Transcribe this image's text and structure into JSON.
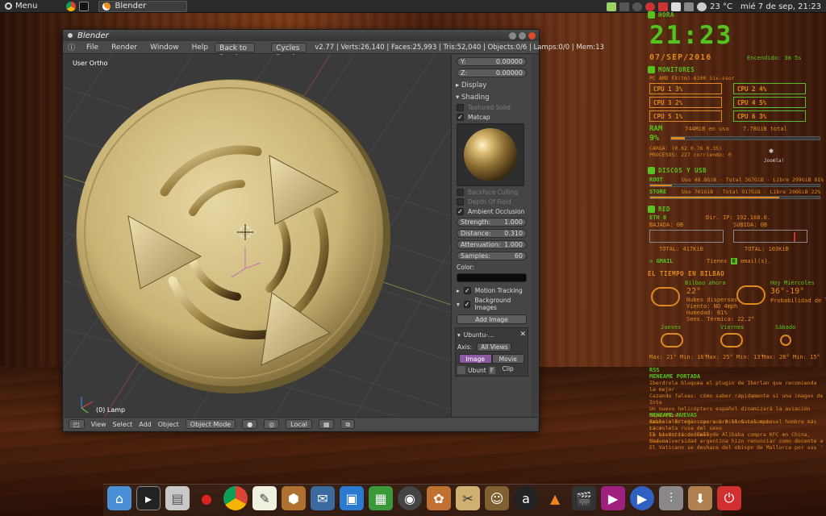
{
  "top_panel": {
    "menu_label": "Menu",
    "active_window": "Blender",
    "temperature": "23 °C",
    "datetime": "mié 7 de sep, 21:23"
  },
  "blender": {
    "title": "Blender",
    "menus": [
      "File",
      "Render",
      "Window",
      "Help"
    ],
    "back_button": "Back to Previous",
    "engine": "Cycles Render",
    "stats": "v2.77 | Verts:26,140 | Faces:25,993 | Tris:52,040 | Objects:0/6 | Lamps:0/0 | Mem:13",
    "viewport_label": "User Ortho",
    "lamp_label": "(0) Lamp",
    "npanel": {
      "y_label": "Y:",
      "y_value": "0.00000",
      "z_label": "Z:",
      "z_value": "0.00000",
      "display": "Display",
      "shading": "Shading",
      "textured_solid": "Textured Solid",
      "matcap": "Matcap",
      "backface_culling": "Backface Culling",
      "depth_of_field": "Depth Of Field",
      "ambient_occlusion": "Ambient Occlusion",
      "strength_label": "Strength:",
      "strength_value": "1.000",
      "distance_label": "Distance:",
      "distance_value": "0.310",
      "attenuation_label": "Attenuation:",
      "attenuation_value": "1.000",
      "samples_label": "Samples:",
      "samples_value": "60",
      "color_label": "Color:",
      "motion_tracking": "Motion Tracking",
      "background_images": "Background Images",
      "add_image": "Add Image",
      "image_name": "Ubuntu-...",
      "axis_label": "Axis:",
      "axis_value": "All Views",
      "tab_image": "Image",
      "tab_movie": "Movie Clip",
      "file_field": "Ubunt",
      "file_btn": "F"
    },
    "footer": {
      "view": "View",
      "select": "Select",
      "add": "Add",
      "object": "Object",
      "mode": "Object Mode",
      "orientation": "Local"
    }
  },
  "conky": {
    "hora_head": "HORA",
    "clock": "21:23",
    "date": "07/SEP/2016",
    "uptime": "Encendido: 3m 5s",
    "monitores_head": "MONITORES",
    "cpu_model": "PC AMD FX(tm)-6100 Six-ssor",
    "cpus": [
      {
        "label": "CPU 1",
        "value": "3%"
      },
      {
        "label": "CPU 2",
        "value": "4%"
      },
      {
        "label": "CPU 3",
        "value": "2%"
      },
      {
        "label": "CPU 4",
        "value": "5%"
      },
      {
        "label": "CPU 5",
        "value": "1%"
      },
      {
        "label": "CPU 6",
        "value": "3%"
      }
    ],
    "ram_label": "RAM",
    "ram_pct": "9%",
    "ram_used": "744MiB en uso",
    "ram_total": "7.78GiB total",
    "carga": "CARGA: (0.62 0.76 0.35)",
    "procesos": "PROCESOS: 227  corriendo: 0",
    "discos_head": "DISCOS Y USB",
    "root_label": "ROOT",
    "root_text": "Uso 48.8GiB - Total 367GiB - Libre 299GiB 81%",
    "store_label": "STORE",
    "store_text": "Uso 701GiB - Total 917GiB - Libre 206GiB 22%",
    "red_head": "RED",
    "eth": "ETH 0",
    "dir_ip": "Dir. IP: 192.168.0.",
    "bajada": "BAJADA: 0B",
    "subida": "SUBIDA: 0B",
    "total_down": "TOTAL: 417KiB",
    "total_up": "TOTAL: 103KiB",
    "gmail_label": "GMAIL",
    "gmail_text": "Tienes",
    "gmail_count": "0",
    "gmail_suffix": "email(s).",
    "tiempo_head": "EL TIEMPO EN BILBAO",
    "bilbao_ahora": "Bilbao ahora",
    "temp_now": "22°",
    "cond_now": "Nubes dispersas",
    "viento": "Viento: NO 4mph",
    "humedad": "Humedad: 81%",
    "sensacion": "Sens. Térmica: 22.2°",
    "hoy": "Hoy Miércoles",
    "hoy_range": "36°-19°",
    "hoy_prob": "Probabilidad de llu",
    "forecast": [
      {
        "day": "Jueves",
        "range": "Max: 21°  Min: 16°"
      },
      {
        "day": "Viernes",
        "range": "Max: 25°  Min: 13°"
      },
      {
        "day": "Sábado",
        "range": "Max: 26°  Min: 15°"
      }
    ],
    "rss_head": "RSS",
    "rss_portada": "MENEAME PORTADA",
    "rss_portada_items": [
      "Iberdrola bloquea el plugin de Iberlan que recomienda la mejor",
      "Cazando falses: cómo saber rápidamente si una imagen de Inte",
      "Un nuevo helicóptero español dinamizará la aviación deportiva",
      "Amancio Ortega supera a Bill Gates como el hombre más rico",
      "El excéntrico dueño de Alibaba compra KFC en China, cadena"
    ],
    "rss_nuevas": "MENEAME NUEVAS",
    "rss_nuevas_items": [
      "Cable eléctrico cae sobre unos columpios",
      "La ruleta rusa del sexo",
      "La historia de Emily",
      "Una universidad argentina hizo renunciar como docente a un c",
      "El Vaticano se deshace del obispo de Mallorca por sus 'líos' con"
    ],
    "joomla": "Joomla!"
  },
  "colors": {
    "conky_green": "#58c020",
    "conky_orange": "#e08a1e",
    "blender_bg": "#3f3f3f"
  }
}
